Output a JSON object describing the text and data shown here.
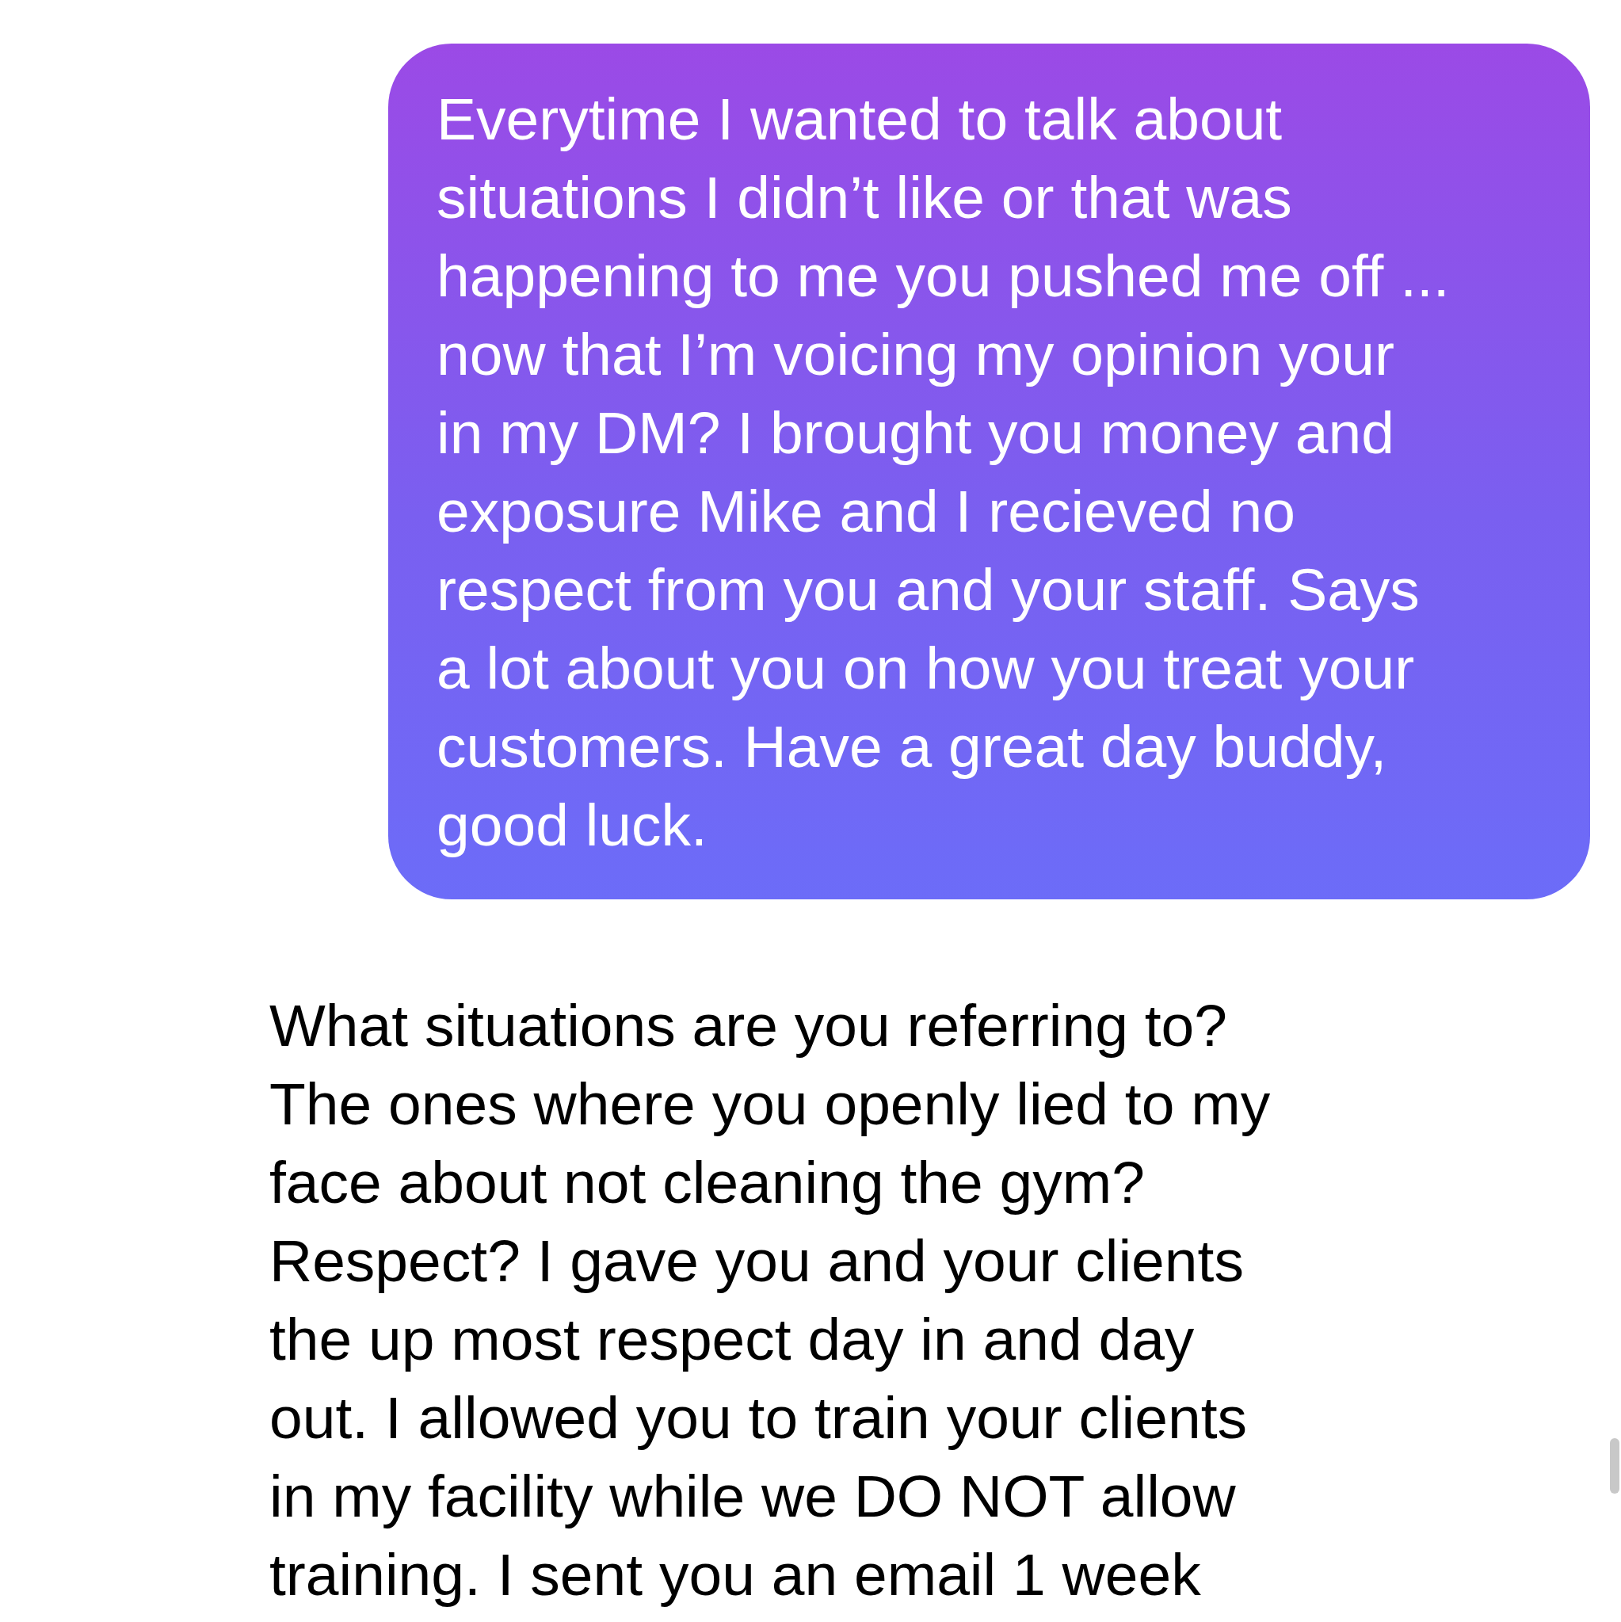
{
  "messages": [
    {
      "kind": "sent",
      "lines": [
        "Everytime I wanted to talk about",
        "situations I didn’t like or that was",
        "happening to me you pushed me off ...",
        "now that I’m voicing my opinion your",
        "in my DM? I brought you money and",
        "exposure Mike and I recieved no",
        "respect from you and your staff. Says",
        "a lot about you on how you treat your",
        "customers. Have a great day buddy,",
        "good luck."
      ]
    },
    {
      "kind": "received",
      "lines": [
        "What situations are you referring to?",
        "The ones where you openly lied to my",
        "face about not cleaning the gym?",
        "Respect? I gave you and your clients",
        "the up most respect day in and day",
        "out. I allowed you to train your clients",
        "in my facility while we DO NOT allow",
        "training. I sent you an email 1 week"
      ]
    }
  ]
}
